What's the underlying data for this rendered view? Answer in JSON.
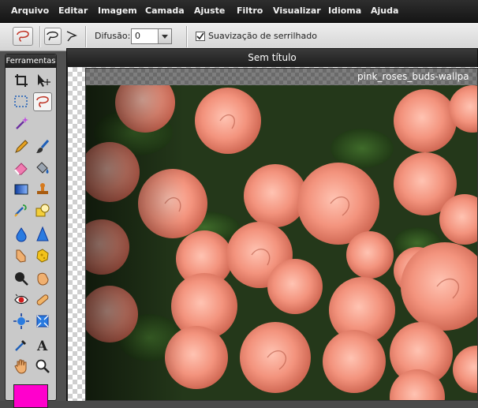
{
  "menubar": {
    "items": [
      "Arquivo",
      "Editar",
      "Imagem",
      "Camada",
      "Ajuste",
      "Filtro",
      "Visualizar",
      "Idioma",
      "Ajuda"
    ]
  },
  "options": {
    "feather_label": "Difusão:",
    "feather_value": "0",
    "antialias_label": "Suavização de serrilhado",
    "antialias_checked": true
  },
  "tools": {
    "title": "Ferramentas",
    "list": [
      "crop",
      "move",
      "marquee",
      "lasso",
      "magic-wand",
      "pencil",
      "brush",
      "eraser",
      "paint-bucket",
      "gradient",
      "clone-stamp",
      "color-replace",
      "shape",
      "blur",
      "sharpen",
      "smudge",
      "sponge",
      "dodge",
      "burn",
      "red-eye",
      "spot-heal",
      "bloat",
      "pinch",
      "color-picker",
      "type",
      "hand",
      "zoom"
    ],
    "foreground_color": "#ff00cc"
  },
  "document": {
    "title": "Sem título"
  },
  "image_window": {
    "title": "pink_roses_buds-wallpa"
  }
}
